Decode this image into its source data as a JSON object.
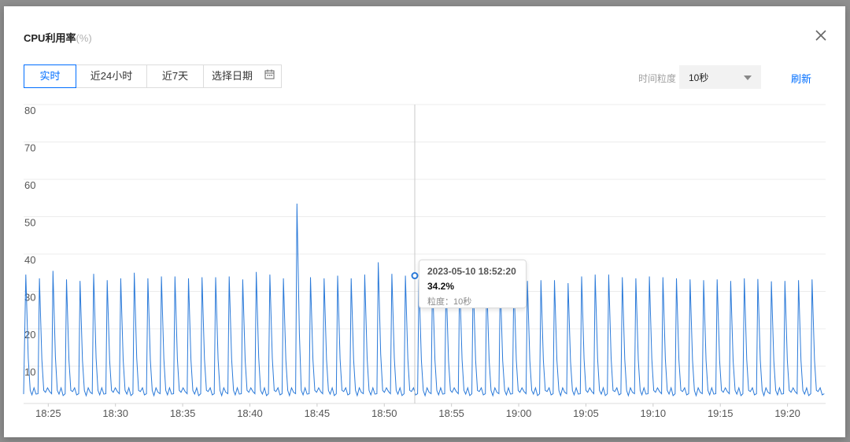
{
  "dialog": {
    "title": "CPU利用率",
    "title_unit": "(%)",
    "close_icon": "close-icon"
  },
  "toolbar": {
    "ranges": [
      "实时",
      "近24小时",
      "近7天"
    ],
    "active_range": "实时",
    "date_picker_label": "选择日期",
    "date_picker_icon": "calendar-icon",
    "granularity_label": "时间粒度",
    "granularity_value": "10秒",
    "granularity_icon": "caret-down-icon",
    "refresh_label": "刷新"
  },
  "tooltip": {
    "time": "2023-05-10 18:52:20",
    "value": "34.2%",
    "granularity": "粒度：10秒"
  },
  "colors": {
    "accent": "#006eff",
    "line": "#2b7ad9"
  },
  "chart_data": {
    "type": "line",
    "title": "CPU利用率(%)",
    "y_ticks": [
      "80",
      "70",
      "60",
      "50",
      "40",
      "30",
      "20",
      "10"
    ],
    "x_ticks": [
      "18:25",
      "18:30",
      "18:35",
      "18:40",
      "18:45",
      "18:50",
      "18:55",
      "19:00",
      "19:05",
      "19:10",
      "19:15",
      "19:20"
    ],
    "ylim": [
      0,
      80
    ],
    "x_range": [
      "18:23:10",
      "19:22:50"
    ],
    "grid": true,
    "series": [
      {
        "peaks": [
          34.5,
          33.5,
          35.5,
          33.2,
          32.8,
          34.7,
          33.0,
          33.5,
          35.0,
          33.5,
          34.0,
          34.0,
          33.5,
          33.8,
          33.8,
          34.0,
          33.2,
          35.2,
          34.5,
          33.5,
          53.5,
          33.8,
          33.5,
          34.2,
          33.5,
          34.5,
          37.8,
          34.7,
          34.2,
          33.2,
          33.5,
          32.8,
          33.5,
          33.2,
          33.0,
          32.8,
          33.3,
          32.8,
          33.0,
          33.0,
          32.2,
          34.0,
          34.5,
          34.5,
          33.8,
          33.5,
          34.0,
          33.8,
          33.5,
          33.2,
          33.0,
          33.2,
          32.8,
          33.5,
          33.3,
          32.7,
          32.8,
          33.0,
          33.2
        ]
      }
    ]
  }
}
